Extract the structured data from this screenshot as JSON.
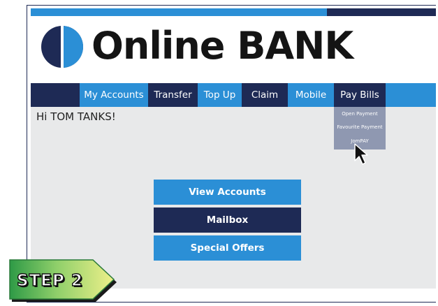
{
  "header": {
    "brand_title": "Online BANK",
    "logo_icon": "half-circle-logo-icon"
  },
  "nav": {
    "items": [
      {
        "label": "My Accounts"
      },
      {
        "label": "Transfer"
      },
      {
        "label": "Top Up"
      },
      {
        "label": "Claim"
      },
      {
        "label": "Mobile"
      },
      {
        "label": "Pay Bills"
      }
    ]
  },
  "pay_bills_menu": {
    "items": [
      {
        "label": "Open Payment"
      },
      {
        "label": "Favourite Payment"
      },
      {
        "label": "JomPAY"
      }
    ]
  },
  "main": {
    "greeting": "Hi TOM TANKS!",
    "buttons": [
      {
        "label": "View Accounts"
      },
      {
        "label": "Mailbox"
      },
      {
        "label": "Special Offers"
      }
    ]
  },
  "step_badge": {
    "label": "STEP 2"
  },
  "colors": {
    "navy": "#1e2a55",
    "blue": "#2b8fd6",
    "content_bg": "#e8e9ea",
    "dropdown_bg": "#8f98b1",
    "step_green": "#2e9a46",
    "step_yellow": "#eef08a"
  }
}
